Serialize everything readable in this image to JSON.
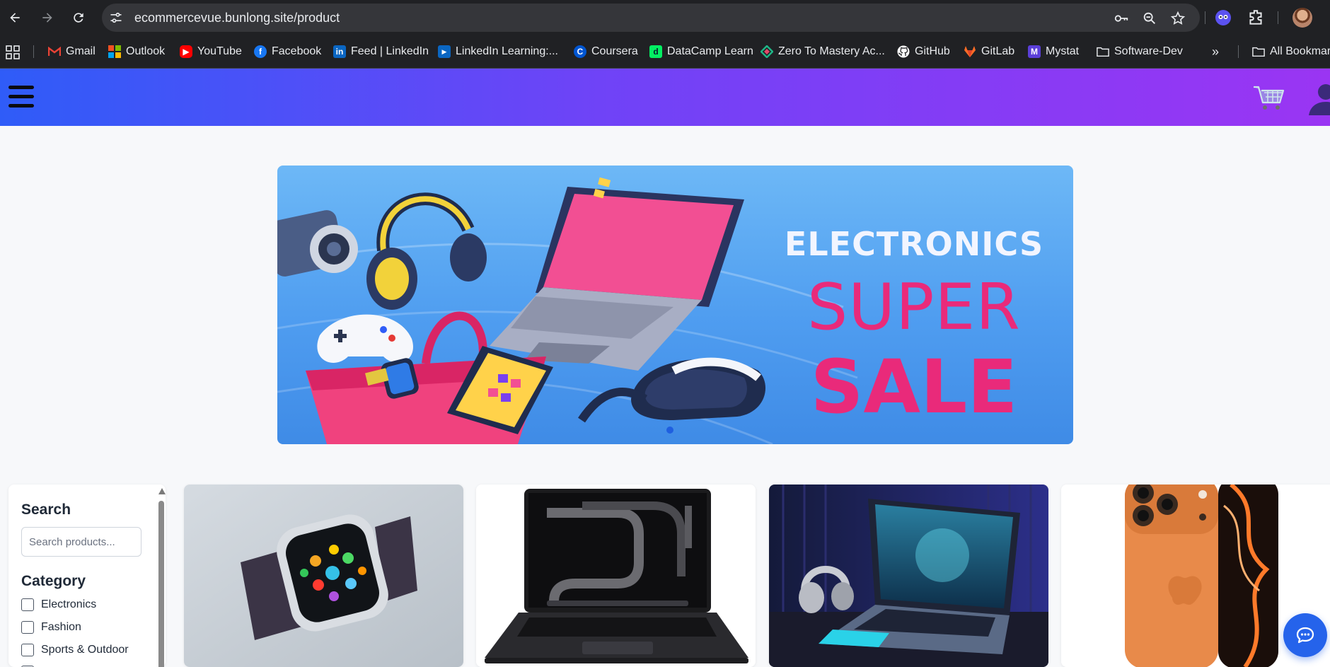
{
  "browser": {
    "url": "ecommercevue.bunlong.site/product",
    "bookmarks": [
      {
        "label": "Gmail",
        "icon": "gmail-icon",
        "color": "#ea4335"
      },
      {
        "label": "Outlook",
        "icon": "outlook-icon",
        "color": "#0078d4"
      },
      {
        "label": "YouTube",
        "icon": "youtube-icon",
        "color": "#ff0000"
      },
      {
        "label": "Facebook",
        "icon": "facebook-icon",
        "color": "#1877f2"
      },
      {
        "label": "Feed | LinkedIn",
        "icon": "linkedin-icon",
        "color": "#0a66c2"
      },
      {
        "label": "LinkedIn Learning:...",
        "icon": "linkedin-learning-icon",
        "color": "#0a66c2"
      },
      {
        "label": "Coursera",
        "icon": "coursera-icon",
        "color": "#0056d2"
      },
      {
        "label": "DataCamp Learn",
        "icon": "datacamp-icon",
        "color": "#03ef62"
      },
      {
        "label": "Zero To Mastery Ac...",
        "icon": "zero-to-mastery-icon",
        "color": "#1fb587"
      },
      {
        "label": "GitHub",
        "icon": "github-icon",
        "color": "#ffffff"
      },
      {
        "label": "GitLab",
        "icon": "gitlab-icon",
        "color": "#fc6d26"
      },
      {
        "label": "Mystat",
        "icon": "mystat-icon",
        "color": "#5b3fd9"
      },
      {
        "label": "Software-Dev",
        "icon": "folder-icon",
        "color": "#e8eaed"
      }
    ],
    "all_bookmarks_label": "All Bookmarks"
  },
  "header": {
    "menu_icon": "hamburger-menu-icon",
    "cart_icon": "shopping-cart-icon",
    "user_icon": "user-avatar-icon",
    "gradient_start": "#2f5cf8",
    "gradient_end": "#9a35f3"
  },
  "banner": {
    "line1": "ELECTRONICS",
    "line2": "SUPER",
    "line3": "SALE"
  },
  "filters": {
    "search_heading": "Search",
    "search_placeholder": "Search products...",
    "category_heading": "Category",
    "categories": [
      {
        "label": "Electronics",
        "checked": false
      },
      {
        "label": "Fashion",
        "checked": false
      },
      {
        "label": "Sports & Outdoor",
        "checked": false
      }
    ]
  },
  "products": [
    {
      "image": "smartwatch"
    },
    {
      "image": "black-laptop"
    },
    {
      "image": "gaming-laptop-with-headphones"
    },
    {
      "image": "orange-smartphone"
    }
  ],
  "chat_icon": "chat-bubble-icon"
}
